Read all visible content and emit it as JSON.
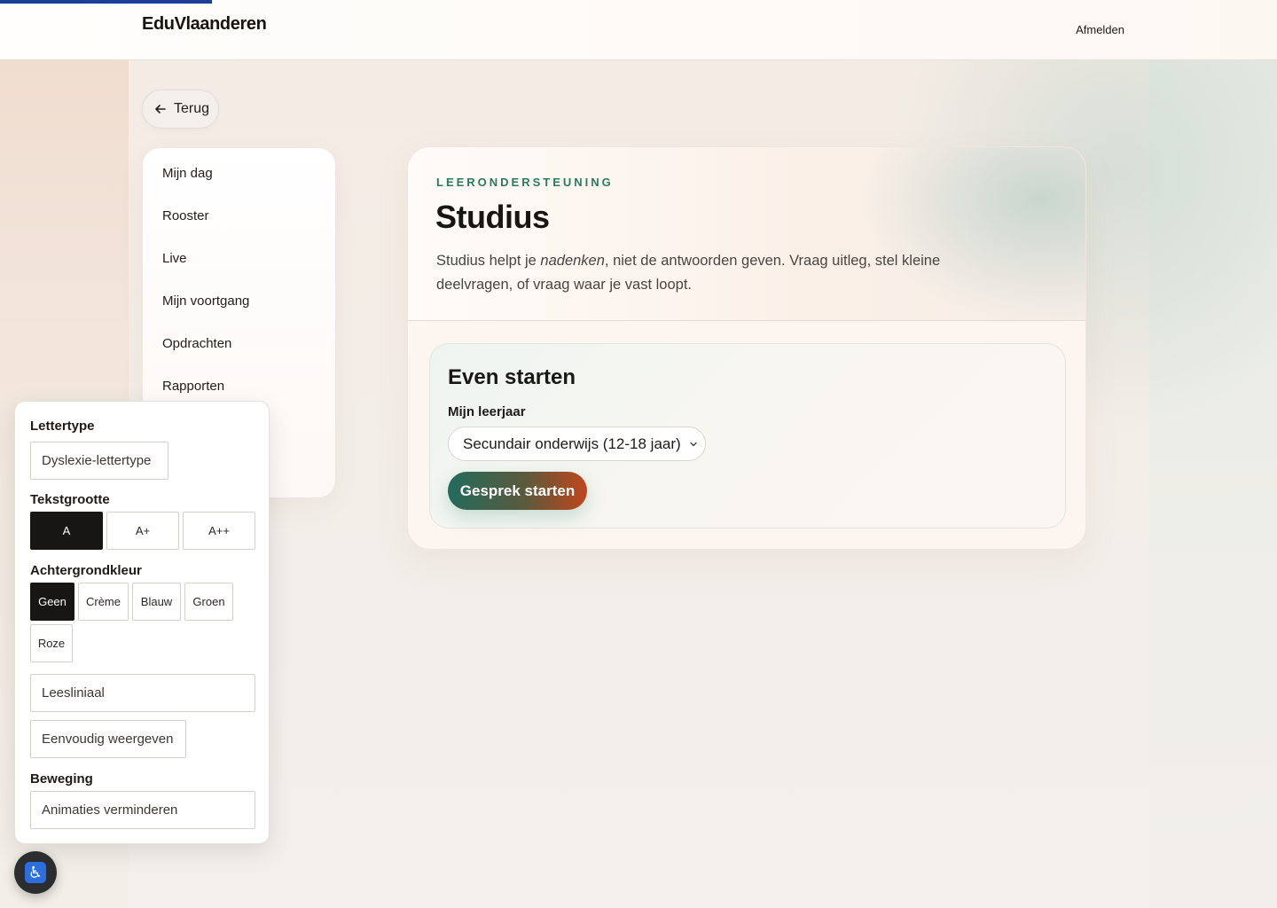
{
  "header": {
    "brand": "EduVlaanderen",
    "logout": "Afmelden",
    "progress": 0.166
  },
  "back": {
    "label": "Terug"
  },
  "nav": {
    "items": [
      {
        "label": "Mijn dag"
      },
      {
        "label": "Rooster"
      },
      {
        "label": "Live"
      },
      {
        "label": "Mijn voortgang"
      },
      {
        "label": "Opdrachten"
      },
      {
        "label": "Rapporten"
      }
    ]
  },
  "hero": {
    "eyebrow": "LEERONDERSTEUNING",
    "title": "Studius",
    "lead_before": "Studius helpt je ",
    "lead_em": "nadenken",
    "lead_after": ", niet de antwoorden geven. Vraag uitleg, stel kleine deelvragen, of vraag waar je vast loopt."
  },
  "start": {
    "title": "Even starten",
    "grade_label": "Mijn leerjaar",
    "grade_value": "Secundair onderwijs (12-18 jaar)",
    "button": "Gesprek starten"
  },
  "accessibility": {
    "font_label": "Lettertype",
    "dyslexia_button": "Dyslexie-lettertype",
    "size_label": "Tekstgrootte",
    "sizes": [
      "A",
      "A+",
      "A++"
    ],
    "size_selected": "A",
    "background_label": "Achtergrondkleur",
    "backgrounds": [
      "Geen",
      "Crème",
      "Blauw",
      "Groen",
      "Roze"
    ],
    "background_selected": "Geen",
    "reading_ruler": "Leesliniaal",
    "simple_view": "Eenvoudig weergeven",
    "motion_label": "Beweging",
    "reduce_animations": "Animaties verminderen",
    "fab_icon": "accessibility-icon"
  },
  "colors": {
    "accent_blue": "#1f3d9b",
    "eyebrow_green": "#2a7a5e",
    "button_gradient_start": "#236b5c",
    "button_gradient_end": "#c0461c"
  }
}
